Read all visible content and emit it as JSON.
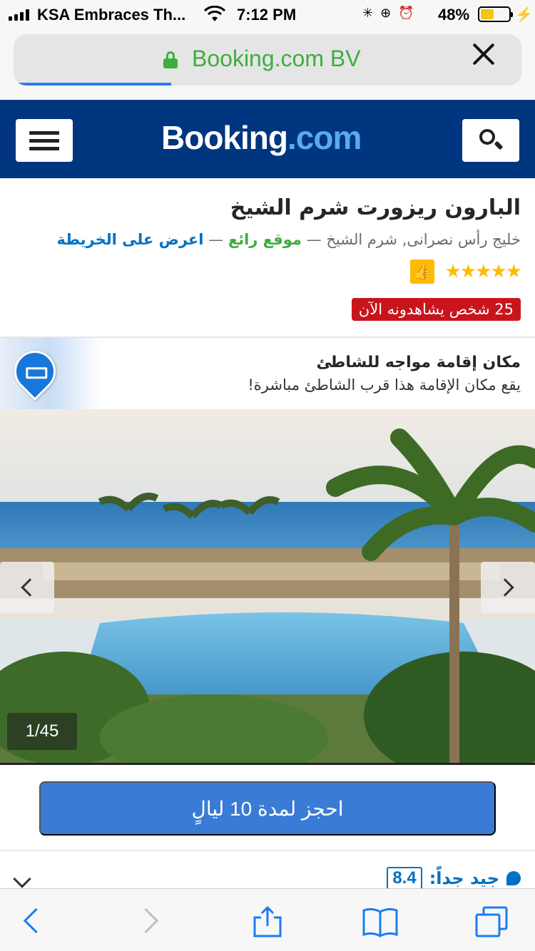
{
  "status_bar": {
    "carrier": "KSA Embraces Th...",
    "time": "7:12 PM",
    "battery_percent": "48%",
    "battery_level": 0.48
  },
  "browser": {
    "url_text": "Booking.com BV",
    "load_progress": 0.31
  },
  "header": {
    "logo_booking": "Booking",
    "logo_com": ".com"
  },
  "hotel": {
    "name": "البارون ريزورت شرم الشيخ",
    "address": "خليج رأس نصرانى, شرم الشيخ",
    "separator": "—",
    "location_label": "موقع رائع",
    "map_link": "اعرض على الخريطة",
    "stars": 5,
    "stars_glyphs": "★★★★★",
    "viewers": "25 شخص يشاهدونه الآن"
  },
  "beach_banner": {
    "title": "مكان إقامة مواجه للشاطئ",
    "subtitle": "يقع مكان الإقامة هذا قرب الشاطئ مباشرة!"
  },
  "gallery": {
    "counter": "1/45"
  },
  "reserve": {
    "button_label": "احجز لمدة 10 ليالٍ"
  },
  "review": {
    "label": "جيد جداً:",
    "score": "8.4"
  },
  "colors": {
    "brand_blue": "#003580",
    "accent_blue": "#0071c2",
    "green": "#3fad3f",
    "star_yellow": "#febb02",
    "badge_red": "#c8151c",
    "button_blue": "#3a7bd5"
  }
}
